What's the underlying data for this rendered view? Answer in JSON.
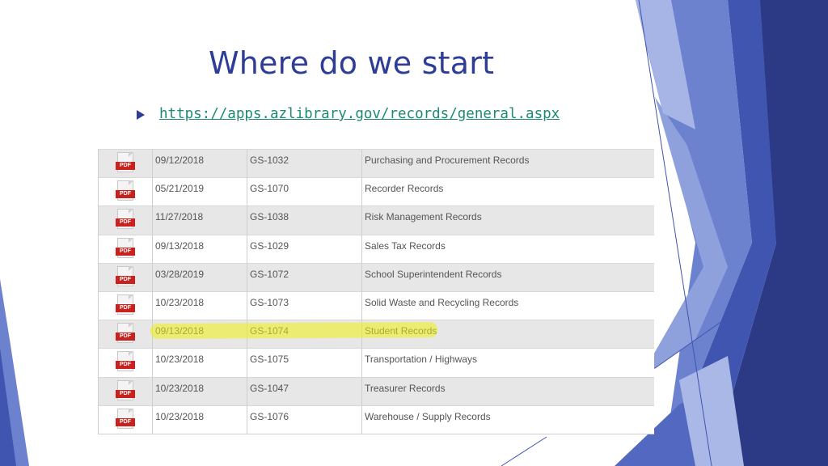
{
  "slide": {
    "title": "Where do we start",
    "link": "https://apps.azlibrary.gov/records/general.aspx"
  },
  "table": {
    "icon_label": "PDF",
    "rows": [
      {
        "date": "09/12/2018",
        "code": "GS-1032",
        "title": "Purchasing and Procurement Records"
      },
      {
        "date": "05/21/2019",
        "code": "GS-1070",
        "title": "Recorder Records"
      },
      {
        "date": "11/27/2018",
        "code": "GS-1038",
        "title": "Risk Management Records"
      },
      {
        "date": "09/13/2018",
        "code": "GS-1029",
        "title": "Sales Tax Records"
      },
      {
        "date": "03/28/2019",
        "code": "GS-1072",
        "title": "School Superintendent Records"
      },
      {
        "date": "10/23/2018",
        "code": "GS-1073",
        "title": "Solid Waste and Recycling Records"
      },
      {
        "date": "09/13/2018",
        "code": "GS-1074",
        "title": "Student Records"
      },
      {
        "date": "10/23/2018",
        "code": "GS-1075",
        "title": "Transportation / Highways"
      },
      {
        "date": "10/23/2018",
        "code": "GS-1047",
        "title": "Treasurer Records"
      },
      {
        "date": "10/23/2018",
        "code": "GS-1076",
        "title": "Warehouse / Supply Records"
      }
    ]
  },
  "colors": {
    "title": "#2e3d98",
    "link": "#1d8a73",
    "highlight": "#f0f014"
  },
  "icons": [
    "pdf-icon",
    "bullet-arrow-icon"
  ]
}
